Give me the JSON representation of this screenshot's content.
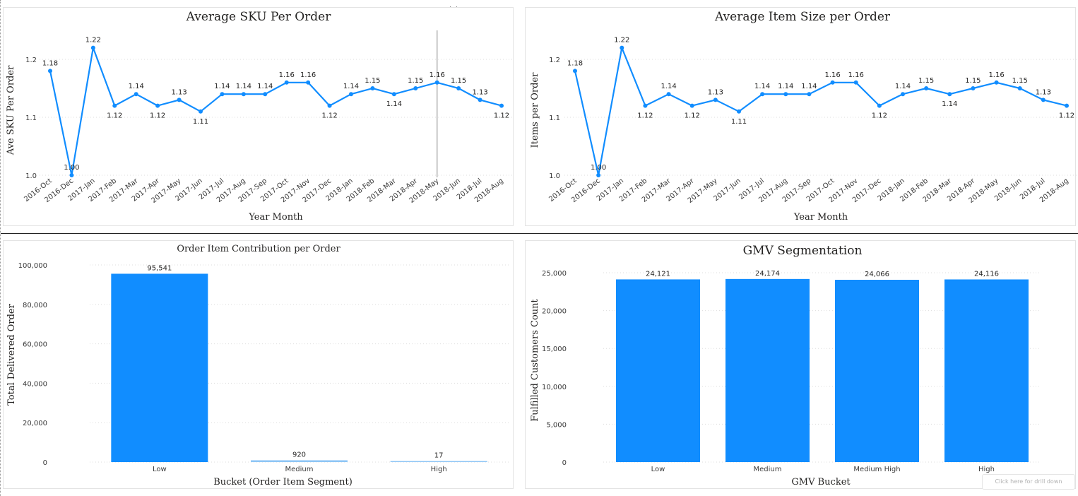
{
  "toolbar": {
    "drill_hint": "Click here for drill down"
  },
  "colors": {
    "series": "#118DFF",
    "series_light": "#8fc6f5",
    "gridline": "#dddddd",
    "cursor_line": "#b3b3b3"
  },
  "chart_data": [
    {
      "type": "line",
      "title": "Average SKU Per Order",
      "xlabel": "Year Month",
      "ylabel": "Ave SKU Per Order",
      "x": [
        "2016-Oct",
        "2016-Dec",
        "2017-Jan",
        "2017-Feb",
        "2017-Mar",
        "2017-Apr",
        "2017-May",
        "2017-Jun",
        "2017-Jul",
        "2017-Aug",
        "2017-Sep",
        "2017-Oct",
        "2017-Nov",
        "2017-Dec",
        "2018-Jan",
        "2018-Feb",
        "2018-Mar",
        "2018-Apr",
        "2018-May",
        "2018-Jun",
        "2018-Jul",
        "2018-Aug"
      ],
      "values": [
        1.18,
        1.0,
        1.22,
        1.12,
        1.14,
        1.12,
        1.13,
        1.11,
        1.14,
        1.14,
        1.14,
        1.16,
        1.16,
        1.12,
        1.14,
        1.15,
        1.14,
        1.15,
        1.16,
        1.15,
        1.13,
        1.12
      ],
      "labels": [
        "1.18",
        "1.00",
        "1.22",
        "1.12",
        "1.14",
        "1.12",
        "1.13",
        "1.11",
        "1.14",
        "1.14",
        "1.14",
        "1.16",
        "1.16",
        "1.12",
        "1.14",
        "1.15",
        "1.14",
        "1.15",
        "1.16",
        "1.15",
        "1.13",
        "1.12"
      ],
      "ylim": [
        1.0,
        1.2
      ],
      "yticks": [
        "1.0",
        "1.1",
        "1.2"
      ],
      "grid": true,
      "cursor_at": "2018-May"
    },
    {
      "type": "line",
      "title": "Average Item Size per Order",
      "xlabel": "Year Month",
      "ylabel": "Items per Order",
      "x": [
        "2016-Oct",
        "2016-Dec",
        "2017-Jan",
        "2017-Feb",
        "2017-Mar",
        "2017-Apr",
        "2017-May",
        "2017-Jun",
        "2017-Jul",
        "2017-Aug",
        "2017-Sep",
        "2017-Oct",
        "2017-Nov",
        "2017-Dec",
        "2018-Jan",
        "2018-Feb",
        "2018-Mar",
        "2018-Apr",
        "2018-May",
        "2018-Jun",
        "2018-Jul",
        "2018-Aug"
      ],
      "values": [
        1.18,
        1.0,
        1.22,
        1.12,
        1.14,
        1.12,
        1.13,
        1.11,
        1.14,
        1.14,
        1.14,
        1.16,
        1.16,
        1.12,
        1.14,
        1.15,
        1.14,
        1.15,
        1.16,
        1.15,
        1.13,
        1.12
      ],
      "labels": [
        "1.18",
        "1.00",
        "1.22",
        "1.12",
        "1.14",
        "1.12",
        "1.13",
        "1.11",
        "1.14",
        "1.14",
        "1.14",
        "1.16",
        "1.16",
        "1.12",
        "1.14",
        "1.15",
        "1.14",
        "1.15",
        "1.16",
        "1.15",
        "1.13",
        "1.12"
      ],
      "ylim": [
        1.0,
        1.2
      ],
      "yticks": [
        "1.0",
        "1.1",
        "1.2"
      ],
      "grid": true
    },
    {
      "type": "bar",
      "title": "Order Item Contribution per Order",
      "xlabel": "Bucket (Order Item Segment)",
      "ylabel": "Total Delivered Order",
      "categories": [
        "Low",
        "Medium",
        "High"
      ],
      "values": [
        95541,
        920,
        17
      ],
      "labels": [
        "95,541",
        "920",
        "17"
      ],
      "ylim": [
        0,
        100000
      ],
      "yticks": [
        "0",
        "20,000",
        "40,000",
        "60,000",
        "80,000",
        "100,000"
      ],
      "bar_colors": [
        "#118DFF",
        "#8fc6f5",
        "#8fc6f5"
      ],
      "grid": true
    },
    {
      "type": "bar",
      "title": "GMV Segmentation",
      "xlabel": "GMV Bucket",
      "ylabel": "Fulfilled Customers Count",
      "categories": [
        "Low",
        "Medium",
        "Medium High",
        "High"
      ],
      "values": [
        24121,
        24174,
        24066,
        24116
      ],
      "labels": [
        "24,121",
        "24,174",
        "24,066",
        "24,116"
      ],
      "ylim": [
        0,
        25000
      ],
      "yticks": [
        "0",
        "5,000",
        "10,000",
        "15,000",
        "20,000",
        "25,000"
      ],
      "bar_colors": [
        "#118DFF",
        "#118DFF",
        "#118DFF",
        "#118DFF"
      ],
      "grid": true
    }
  ]
}
